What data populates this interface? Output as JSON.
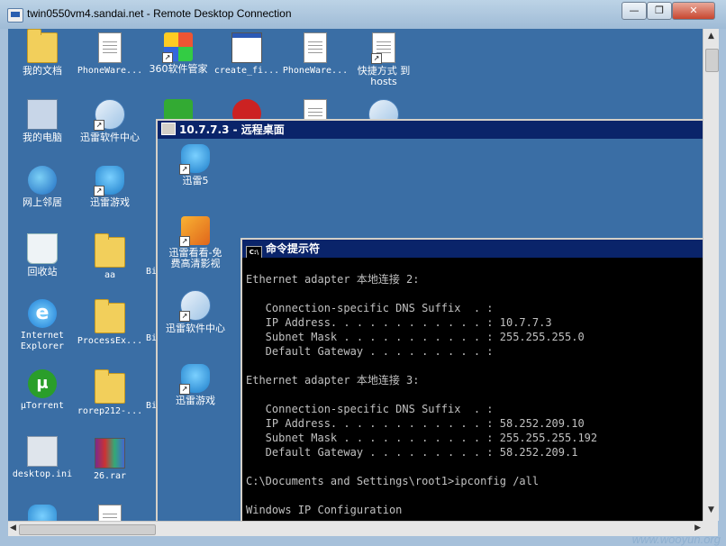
{
  "window": {
    "title": "twin0550vm4.sandai.net - Remote Desktop Connection",
    "minimize": "—",
    "restore": "❐",
    "close": "✕"
  },
  "watermark": "www.wooyun.org",
  "desktop_icons": [
    {
      "label": "我的文档",
      "icon": "my-documents-icon"
    },
    {
      "label": "PhoneWare...",
      "icon": "document-icon"
    },
    {
      "label": "360软件管家",
      "icon": "360-software-manager-icon"
    },
    {
      "label": "create_fi...",
      "icon": "window-icon"
    },
    {
      "label": "PhoneWare...",
      "icon": "document-icon"
    },
    {
      "label": "快捷方式 到\nhosts",
      "icon": "shortcut-file-icon"
    },
    {
      "label": "我的电脑",
      "icon": "my-computer-icon"
    },
    {
      "label": "迅雷软件中心",
      "icon": "thunder-software-center-icon"
    },
    {
      "label": "网上邻居",
      "icon": "network-places-icon"
    },
    {
      "label": "迅雷游戏",
      "icon": "thunder-games-icon"
    },
    {
      "label": "回收站",
      "icon": "recycle-bin-icon"
    },
    {
      "label": "aa",
      "icon": "folder-icon"
    },
    {
      "label": "Internet\nExplorer",
      "icon": "internet-explorer-icon"
    },
    {
      "label": "ProcessEx...",
      "icon": "folder-icon"
    },
    {
      "label": "μTorrent",
      "icon": "utorrent-icon"
    },
    {
      "label": "rorep212-...",
      "icon": "folder-icon"
    },
    {
      "label": "desktop.ini",
      "icon": "ini-file-icon"
    },
    {
      "label": "26.rar",
      "icon": "rar-archive-icon"
    }
  ],
  "partial_label": "Bi",
  "inner_rdp": {
    "title": "10.7.7.3 - 远程桌面",
    "icons": [
      {
        "label": "迅雷5",
        "icon": "thunder5-icon"
      },
      {
        "label": "迅雷看看-免\n费高清影视",
        "icon": "thunder-kankan-icon"
      },
      {
        "label": "迅雷软件中心",
        "icon": "thunder-software-center-icon"
      },
      {
        "label": "迅雷游戏",
        "icon": "thunder-games-icon"
      }
    ]
  },
  "cmd": {
    "title": "命令提示符",
    "title_icon": "C:\\",
    "lines": [
      "",
      "Ethernet adapter 本地连接 2:",
      "",
      "   Connection-specific DNS Suffix  . :",
      "   IP Address. . . . . . . . . . . . : 10.7.7.3",
      "   Subnet Mask . . . . . . . . . . . : 255.255.255.0",
      "   Default Gateway . . . . . . . . . :",
      "",
      "Ethernet adapter 本地连接 3:",
      "",
      "   Connection-specific DNS Suffix  . :",
      "   IP Address. . . . . . . . . . . . : 58.252.209.10",
      "   Subnet Mask . . . . . . . . . . . : 255.255.255.192",
      "   Default Gateway . . . . . . . . . : 58.252.209.1",
      "",
      "C:\\Documents and Settings\\root1>ipconfig /all",
      "",
      "Windows IP Configuration",
      ""
    ]
  }
}
